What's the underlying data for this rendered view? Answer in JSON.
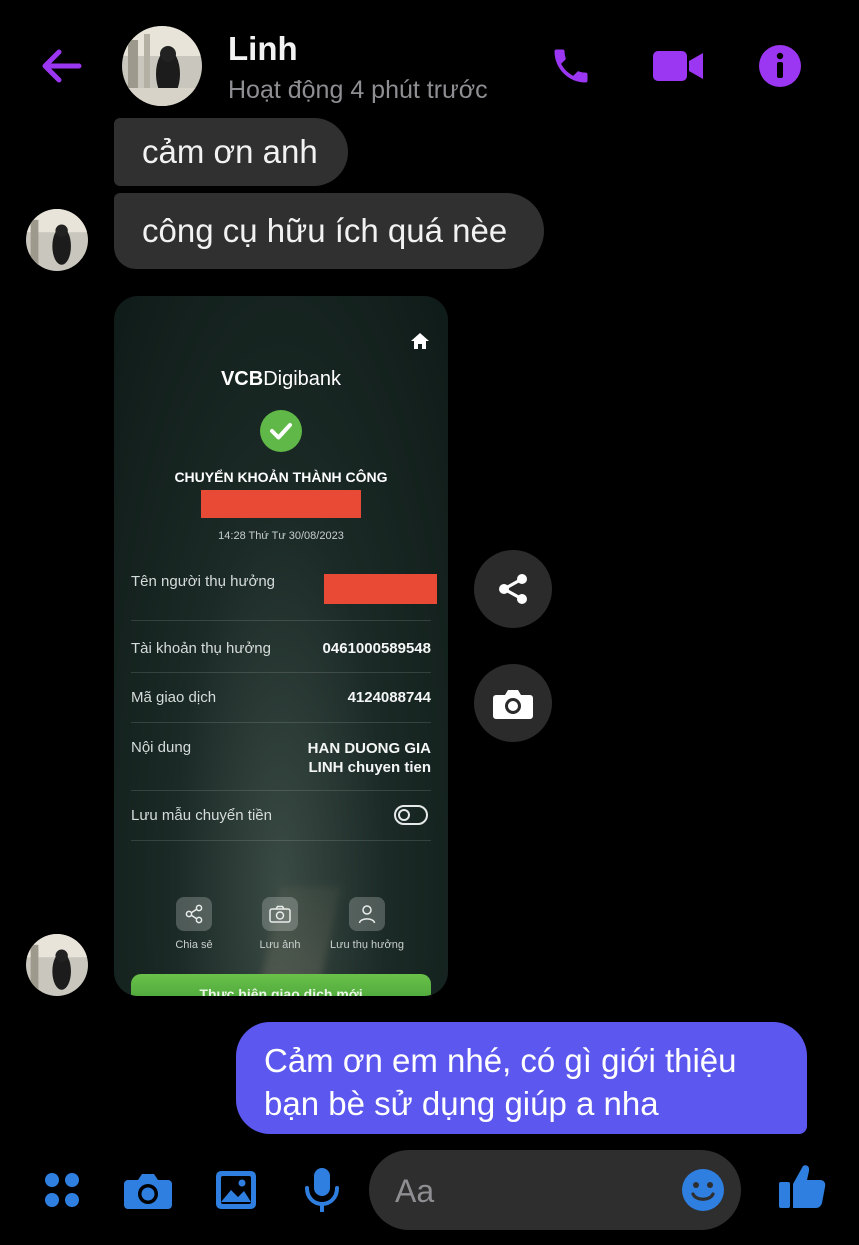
{
  "colors": {
    "accent": "#9b37f2",
    "composer_icon": "#2f7fe0",
    "outgoing_bubble": "#5b57ef",
    "incoming_bubble": "#303030",
    "vcb_green": "#5fb847",
    "redaction": "#e94a35"
  },
  "header": {
    "contact_name": "Linh",
    "status": "Hoạt động 4 phút trước",
    "icons": [
      "back-arrow-icon",
      "phone-icon",
      "video-camera-icon",
      "info-icon"
    ]
  },
  "messages": {
    "incoming": [
      {
        "text": "cảm ơn anh"
      },
      {
        "text": "công cụ hữu ích quá nèe"
      }
    ],
    "outgoing": [
      {
        "line1": "Cảm ơn em nhé, có gì giới thiệu",
        "line2": "bạn bè sử dụng giúp a nha"
      }
    ]
  },
  "receipt": {
    "brand_bold": "VCB",
    "brand_rest": "Digibank",
    "status_title": "CHUYỂN KHOẢN THÀNH CÔNG",
    "datetime": "14:28 Thứ Tư 30/08/2023",
    "rows": [
      {
        "label": "Tên người thụ hưởng",
        "value": ""
      },
      {
        "label": "Tài khoản thụ hưởng",
        "value": "0461000589548"
      },
      {
        "label": "Mã giao dịch",
        "value": "4124088744"
      },
      {
        "label": "Nội dung",
        "value_line1": "HAN DUONG GIA",
        "value_line2": "LINH chuyen tien"
      },
      {
        "label": "Lưu mẫu chuyển tiền",
        "toggle": false
      }
    ],
    "actions": [
      {
        "label": "Chia sẻ",
        "icon": "share-icon"
      },
      {
        "label": "Lưu ảnh",
        "icon": "camera-icon"
      },
      {
        "label": "Lưu thụ hưởng",
        "icon": "user-icon"
      }
    ],
    "cta": "Thực hiện giao dịch mới"
  },
  "floating_actions": [
    "share-icon",
    "camera-icon"
  ],
  "composer": {
    "placeholder": "Aa",
    "icons": [
      "apps-icon",
      "camera-icon",
      "gallery-icon",
      "microphone-icon",
      "emoji-icon",
      "thumbs-up-icon"
    ]
  }
}
